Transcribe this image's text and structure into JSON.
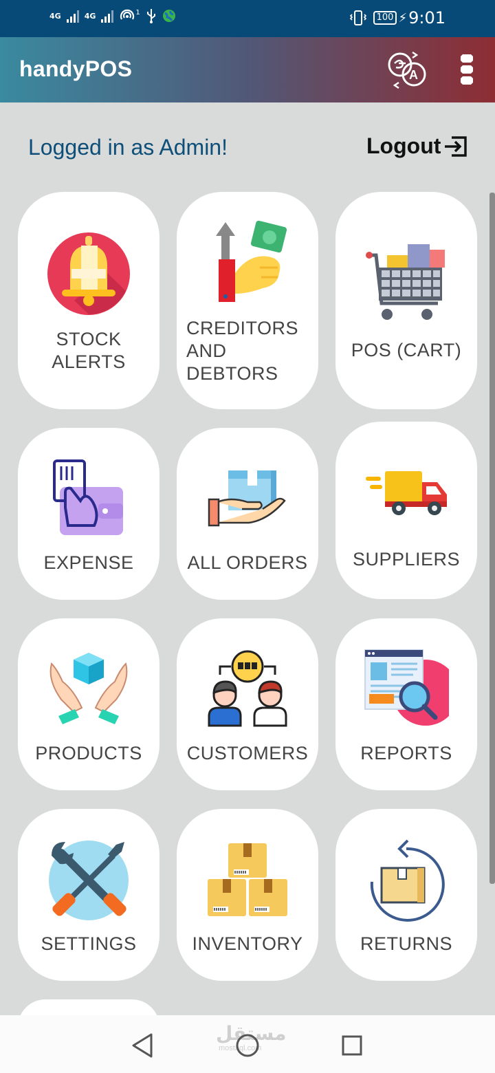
{
  "status_bar": {
    "net1": "4G",
    "net2": "4G",
    "hotspot_count": "1",
    "battery": "100",
    "time": "9:01"
  },
  "app_bar": {
    "title": "handyPOS",
    "translate_icon": "translate-icon",
    "menu_icon": "overflow-menu-icon"
  },
  "session": {
    "logged_in_text": "Logged in as Admin!",
    "logout_label": "Logout"
  },
  "tiles": [
    {
      "label_lines": [
        "STOCK",
        "ALERTS"
      ],
      "icon": "bell-icon"
    },
    {
      "label_lines": [
        "CREDITORS",
        "AND",
        "DEBTORS"
      ],
      "icon": "hand-money-icon"
    },
    {
      "label_lines": [
        "POS (CART)"
      ],
      "icon": "cart-icon"
    },
    {
      "label_lines": [
        "EXPENSE"
      ],
      "icon": "card-wallet-icon"
    },
    {
      "label_lines": [
        "ALL ORDERS"
      ],
      "icon": "hand-box-icon"
    },
    {
      "label_lines": [
        "SUPPLIERS"
      ],
      "icon": "truck-icon"
    },
    {
      "label_lines": [
        "PRODUCTS"
      ],
      "icon": "hands-cube-icon"
    },
    {
      "label_lines": [
        "CUSTOMERS"
      ],
      "icon": "people-icon"
    },
    {
      "label_lines": [
        "REPORTS"
      ],
      "icon": "report-magnifier-icon"
    },
    {
      "label_lines": [
        "SETTINGS"
      ],
      "icon": "tools-icon"
    },
    {
      "label_lines": [
        "INVENTORY"
      ],
      "icon": "boxes-icon"
    },
    {
      "label_lines": [
        "RETURNS"
      ],
      "icon": "return-box-icon"
    }
  ],
  "nav_bar": {
    "back_icon": "back-triangle-icon",
    "home_icon": "home-circle-icon",
    "recents_icon": "recents-square-icon",
    "watermark": "مستقل",
    "watermark_sub": "mostaql.com"
  },
  "colors": {
    "status_bar": "#084a77",
    "app_bar_start": "#3a8aa0",
    "app_bar_end": "#8e2d33",
    "background": "#d9dada",
    "login_text": "#0e4f79"
  }
}
